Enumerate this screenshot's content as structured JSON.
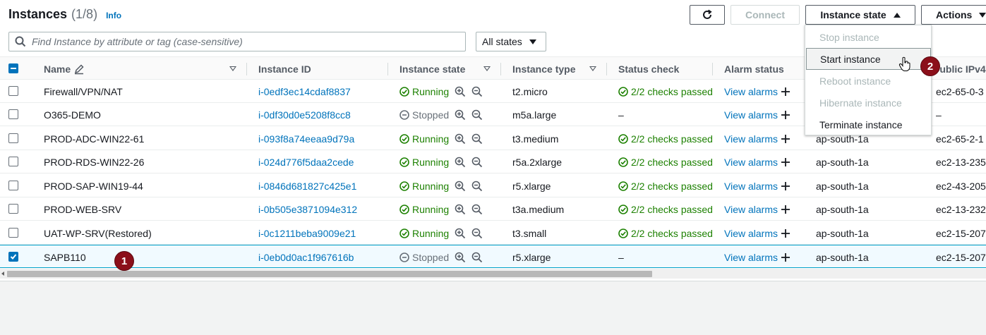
{
  "header": {
    "title": "Instances",
    "count": "(1/8)",
    "info": "Info"
  },
  "toolbar": {
    "connect": "Connect",
    "instance_state": "Instance state",
    "actions": "Actions",
    "refresh_icon": "refresh-icon"
  },
  "search": {
    "placeholder": "Find Instance by attribute or tag (case-sensitive)",
    "value": ""
  },
  "state_filter": {
    "selected": "All states"
  },
  "columns": {
    "name": "Name",
    "instance_id": "Instance ID",
    "instance_state": "Instance state",
    "instance_type": "Instance type",
    "status_check": "Status check",
    "alarm_status": "Alarm status",
    "public_ipv4": "Public IPv4"
  },
  "rows": [
    {
      "name": "Firewall/VPN/NAT",
      "id": "i-0edf3ec14cdaf8837",
      "state": "Running",
      "type": "t2.micro",
      "status": "2/2 checks passed",
      "alarm": "View alarms",
      "az": "",
      "ip": "ec2-65-0-3",
      "checked": false
    },
    {
      "name": "O365-DEMO",
      "id": "i-0df30d0e5208f8cc8",
      "state": "Stopped",
      "type": "m5a.large",
      "status": "–",
      "alarm": "View alarms",
      "az": "",
      "ip": "–",
      "checked": false
    },
    {
      "name": "PROD-ADC-WIN22-61",
      "id": "i-093f8a74eeaa9d79a",
      "state": "Running",
      "type": "t3.medium",
      "status": "2/2 checks passed",
      "alarm": "View alarms",
      "az": "ap-south-1a",
      "ip": "ec2-65-2-1",
      "checked": false
    },
    {
      "name": "PROD-RDS-WIN22-26",
      "id": "i-024d776f5daa2cede",
      "state": "Running",
      "type": "r5a.2xlarge",
      "status": "2/2 checks passed",
      "alarm": "View alarms",
      "az": "ap-south-1a",
      "ip": "ec2-13-235",
      "checked": false
    },
    {
      "name": "PROD-SAP-WIN19-44",
      "id": "i-0846d681827c425e1",
      "state": "Running",
      "type": "r5.xlarge",
      "status": "2/2 checks passed",
      "alarm": "View alarms",
      "az": "ap-south-1a",
      "ip": "ec2-43-205",
      "checked": false
    },
    {
      "name": "PROD-WEB-SRV",
      "id": "i-0b505e3871094e312",
      "state": "Running",
      "type": "t3a.medium",
      "status": "2/2 checks passed",
      "alarm": "View alarms",
      "az": "ap-south-1a",
      "ip": "ec2-13-232",
      "checked": false
    },
    {
      "name": "UAT-WP-SRV(Restored)",
      "id": "i-0c1211beba9009e21",
      "state": "Running",
      "type": "t3.small",
      "status": "2/2 checks passed",
      "alarm": "View alarms",
      "az": "ap-south-1a",
      "ip": "ec2-15-207",
      "checked": false
    },
    {
      "name": "SAPB110",
      "id": "i-0eb0d0ac1f967616b",
      "state": "Stopped",
      "type": "r5.xlarge",
      "status": "–",
      "alarm": "View alarms",
      "az": "ap-south-1a",
      "ip": "ec2-15-207",
      "checked": true
    }
  ],
  "menu": {
    "items": [
      {
        "label": "Stop instance",
        "disabled": true
      },
      {
        "label": "Start instance",
        "disabled": false,
        "hover": true
      },
      {
        "label": "Reboot instance",
        "disabled": true
      },
      {
        "label": "Hibernate instance",
        "disabled": true
      },
      {
        "label": "Terminate instance",
        "disabled": false
      }
    ]
  },
  "badges": {
    "first": "1",
    "second": "2"
  },
  "colors": {
    "running": "#1d8102",
    "stopped": "#687078",
    "link": "#0073bb",
    "badge": "#8b0f1a"
  }
}
